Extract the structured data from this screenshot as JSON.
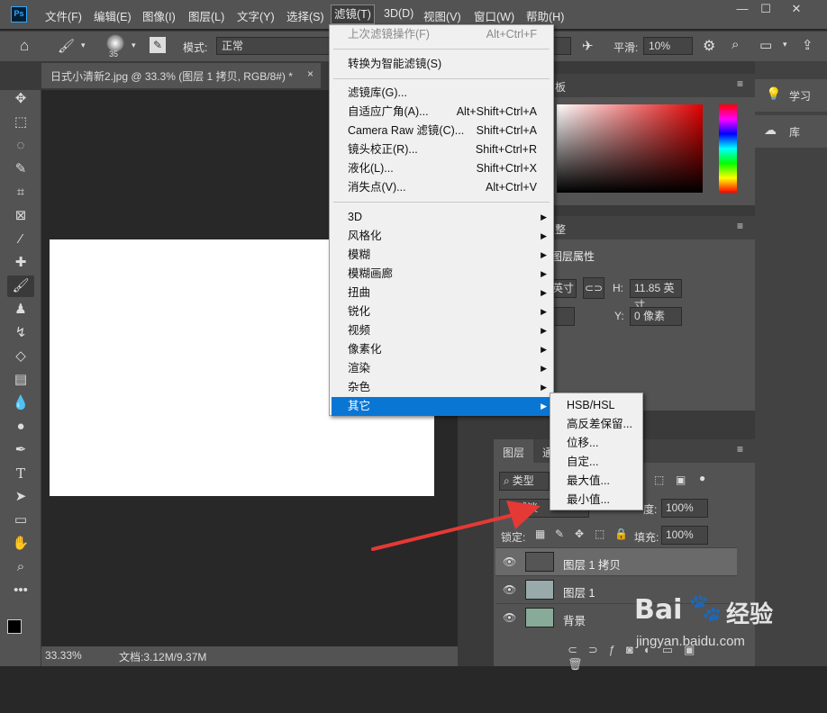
{
  "app": {
    "logo": "Ps"
  },
  "menubar": {
    "items": [
      "文件(F)",
      "编辑(E)",
      "图像(I)",
      "图层(L)",
      "文字(Y)",
      "选择(S)",
      "滤镜(T)",
      "3D(D)",
      "视图(V)",
      "窗口(W)",
      "帮助(H)"
    ],
    "active": "滤镜(T)"
  },
  "window_controls": {
    "minimize": "—",
    "maximize": "☐",
    "close": "✕"
  },
  "options": {
    "brush_size": "35",
    "mode_label": "模式:",
    "mode_value": "正常",
    "smooth_label": "平滑:",
    "smooth_value": "10%"
  },
  "document": {
    "tab_title": "日式小清新2.jpg @ 33.3% (图层 1 拷贝, RGB/8#) *",
    "tab_close": "×",
    "zoom": "33.33%",
    "doc_info": "文档:3.12M/9.37M"
  },
  "filter_menu": {
    "last_filter": {
      "label": "上次滤镜操作(F)",
      "shortcut": "Alt+Ctrl+F"
    },
    "smart": "转换为智能滤镜(S)",
    "group1": [
      {
        "label": "滤镜库(G)...",
        "shortcut": ""
      },
      {
        "label": "自适应广角(A)...",
        "shortcut": "Alt+Shift+Ctrl+A"
      },
      {
        "label": "Camera Raw 滤镜(C)...",
        "shortcut": "Shift+Ctrl+A"
      },
      {
        "label": "镜头校正(R)...",
        "shortcut": "Shift+Ctrl+R"
      },
      {
        "label": "液化(L)...",
        "shortcut": "Shift+Ctrl+X"
      },
      {
        "label": "消失点(V)...",
        "shortcut": "Alt+Ctrl+V"
      }
    ],
    "submenus": [
      "3D",
      "风格化",
      "模糊",
      "模糊画廊",
      "扭曲",
      "锐化",
      "视频",
      "像素化",
      "渲染",
      "杂色",
      "其它"
    ],
    "highlighted": "其它"
  },
  "other_submenu": [
    "HSB/HSL",
    "高反差保留...",
    "位移...",
    "自定...",
    "最大值...",
    "最小值..."
  ],
  "panels": {
    "color_tab": "板",
    "adjust_tab": "整",
    "properties_title": "图层属性",
    "w_value": "英寸",
    "h_label": "H:",
    "h_value": "11.85 英寸",
    "y_label": "Y:",
    "y_value": "0 像素",
    "learn_label": "学习",
    "library_label": "库"
  },
  "layers_panel": {
    "tab_layers": "图层",
    "tab_other": "通",
    "filter_kind": "类型",
    "blend_mode": "减淡",
    "opacity_label": "度:",
    "opacity_value": "100%",
    "lock_label": "锁定:",
    "fill_label": "填充:",
    "fill_value": "100%",
    "layers": [
      {
        "name": "图层 1 拷贝",
        "selected": true
      },
      {
        "name": "图层 1",
        "selected": false
      },
      {
        "name": "背景",
        "selected": false
      }
    ]
  },
  "watermark": {
    "brand": "Bai",
    "brand2": "经验",
    "url": "jingyan.baidu.com"
  },
  "colors": {
    "accent": "#0a76d4",
    "arrow": "#e53935"
  }
}
